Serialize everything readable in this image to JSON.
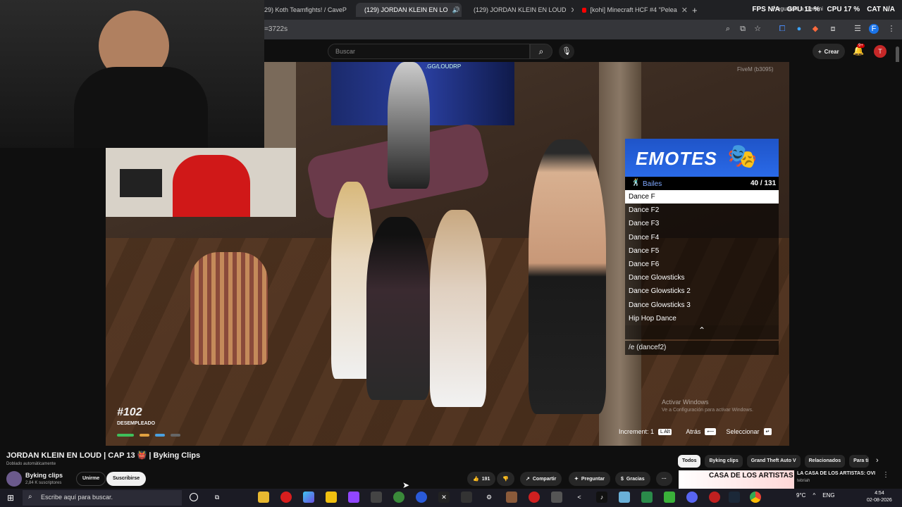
{
  "browser": {
    "tabs": [
      {
        "label": "29) Koth Teamfights! / CaveP"
      },
      {
        "label": "(129) JORDAN KLEIN EN LO"
      },
      {
        "label": "(129) JORDAN KLEIN EN LOUD"
      },
      {
        "label": "[kohi] Minecraft HCF #4 \"Pelea"
      }
    ],
    "new_tab": "+",
    "url": "=3722s",
    "overlay": {
      "fps": "FPS N/A",
      "gpu": "GPU 11 %",
      "cpu": "CPU 17 %",
      "cpu_temp": "CAT N/A",
      "tooltip": "Preguntale a Gemini"
    }
  },
  "youtube": {
    "search_placeholder": "Buscar",
    "create_label": "Crear",
    "notif_count": "9+",
    "avatar_letter": "T"
  },
  "video": {
    "gg_label": ".GG/LOUDRP",
    "fivem_label": "FiveM (b3095)",
    "player_id": "#102",
    "player_job": "DESEMPLEADO",
    "emotes": {
      "title": "EMOTES",
      "category": "Bailes",
      "count": "40 / 131",
      "items": [
        "Dance F",
        "Dance F2",
        "Dance F3",
        "Dance F4",
        "Dance F5",
        "Dance F6",
        "Dance Glowsticks",
        "Dance Glowsticks 2",
        "Dance Glowsticks 3",
        "Hip Hop Dance"
      ],
      "selected_index": 0,
      "command": "/e (dancef2)"
    },
    "activate_title": "Activar Windows",
    "activate_sub": "Ve a Configuración para activar Windows.",
    "hints": {
      "increment": "Increment: 1",
      "increment_key": "L Alt",
      "back": "Atrás",
      "select": "Seleccionar"
    }
  },
  "watch": {
    "title": "JORDAN KLEIN EN LOUD | CAP 13 👹 | Byking Clips",
    "dubbed": "Doblado automáticamente",
    "channel_name": "Byking clips",
    "channel_subs": "2,84 K suscriptores",
    "join_label": "Unirme",
    "subscribe_label": "Suscribirse",
    "likes": "191",
    "share_label": "Compartir",
    "ask_label": "Preguntar",
    "thanks_label": "Gracias",
    "more_label": "···",
    "chips": [
      "Todos",
      "Byking clips",
      "Grand Theft Auto V",
      "Relacionados",
      "Para ti"
    ],
    "rec_thumb_text": "CASA DE LOS ARTISTAS",
    "rec_title": "LA CASA DE LOS ARTISTAS: OVI",
    "rec_channel": "tebriah"
  },
  "taskbar": {
    "search_placeholder": "Escribe aquí para buscar.",
    "weather": "9°C",
    "lang": "ENG",
    "time": "4:54",
    "date": "02-08-2026"
  },
  "colors": {
    "accent_red": "#ff0000",
    "emote_banner": "#1f54c8"
  }
}
